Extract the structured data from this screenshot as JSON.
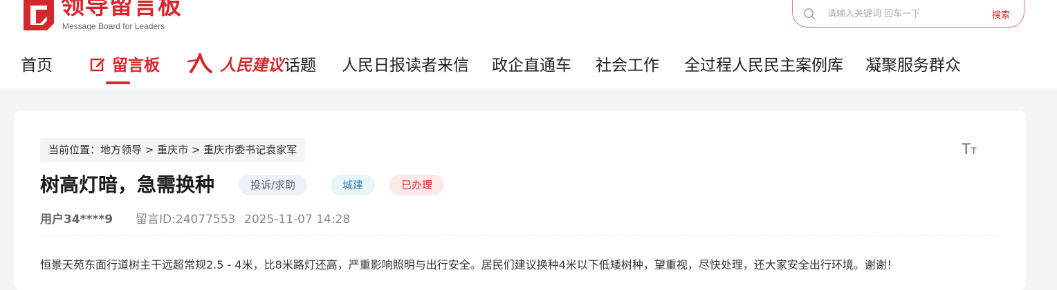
{
  "colors": {
    "brand_red": "#d7262c",
    "page_bg": "#f4f5f7"
  },
  "header": {
    "logo_title": "领导留言板",
    "logo_subtitle": "Message Board for Leaders",
    "search": {
      "placeholder": "请输入关键词 回车一下",
      "button_label": "搜索"
    }
  },
  "nav": {
    "items": [
      {
        "label": "首页"
      },
      {
        "label": "留言板",
        "icon": "edit-icon",
        "active": true
      },
      {
        "label": "人民建议",
        "icon": "renmin-calligraphy-logo"
      },
      {
        "label": "话题"
      },
      {
        "label": "人民日报读者来信"
      },
      {
        "label": "政企直通车"
      },
      {
        "label": "社会工作"
      },
      {
        "label": "全过程人民民主案例库"
      },
      {
        "label": "凝聚服务群众"
      }
    ]
  },
  "message": {
    "breadcrumb": "当前位置：地方领导 > 重庆市 > 重庆市委书记袁家军",
    "font_size_toggle": {
      "big": "T",
      "small": "T"
    },
    "title": "树高灯暗，急需换种",
    "tags": {
      "type": "投诉/求助",
      "category": "城建",
      "status": "已办理"
    },
    "user": "用户34****9",
    "message_id": "留言ID:24077553",
    "time": "2025-11-07 14:28",
    "content": "恒景天苑东面行道树主干远超常规2.5 - 4米，比8米路灯还高，严重影响照明与出行安全。居民们建议换种4米以下低矮树种，望重视，尽快处理，还大家安全出行环境。谢谢！"
  }
}
